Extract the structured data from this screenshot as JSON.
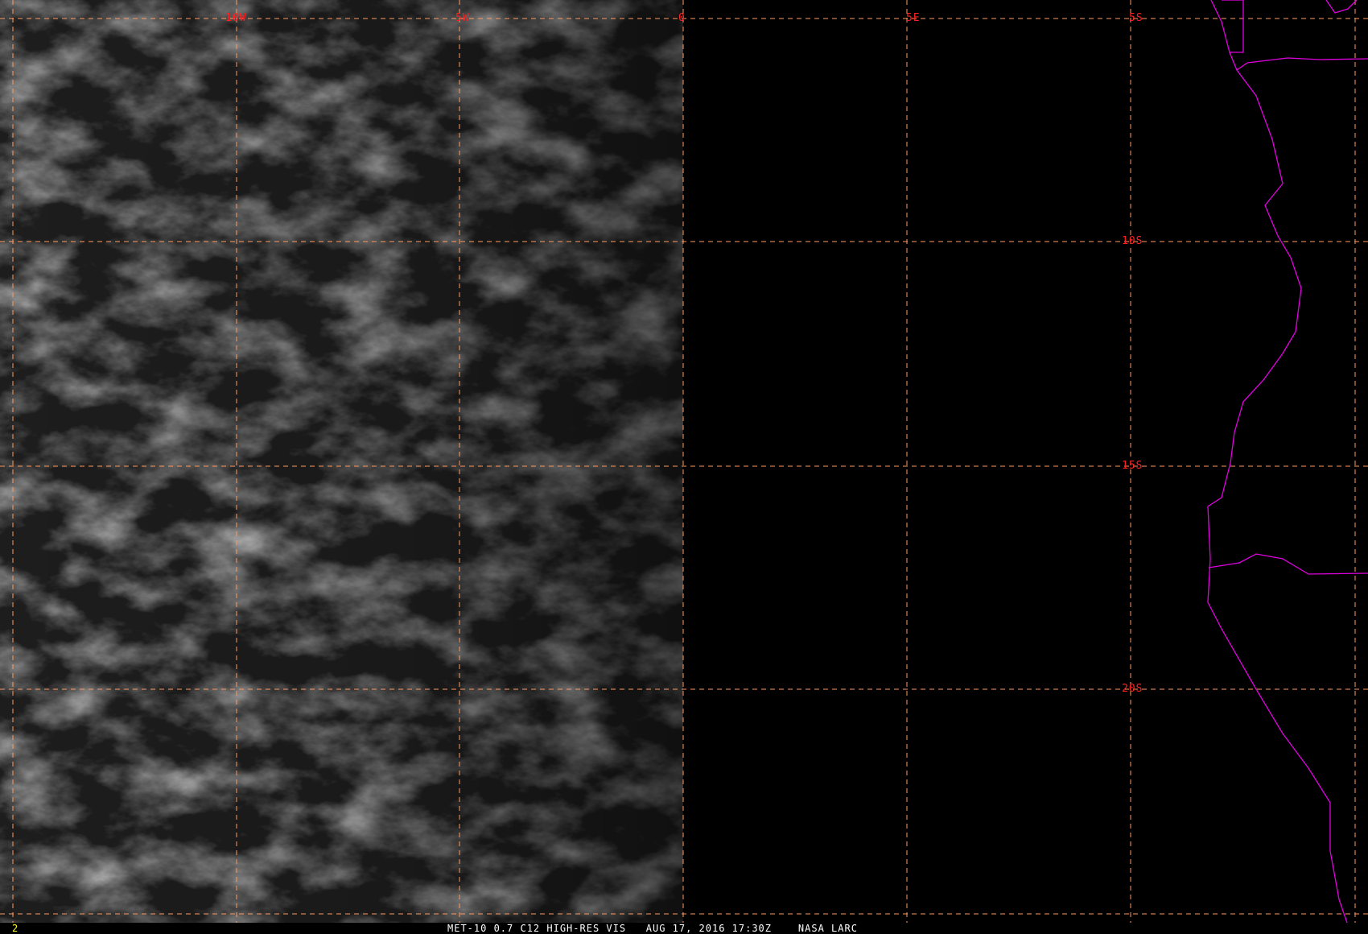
{
  "map": {
    "lon_labels": [
      "10W",
      "5W",
      "0",
      "5E"
    ],
    "lat_labels": [
      "5S",
      "10S",
      "15S",
      "20S"
    ],
    "colors": {
      "grid": "#ff9a60",
      "labels": "#ff2020",
      "coastline": "#e000e0",
      "frame_number": "#ffff30"
    }
  },
  "footer": {
    "frame_number": "2",
    "caption": "MET-10 0.7 C12 HIGH-RES VIS   AUG 17, 2016 17:30Z    NASA LARC"
  }
}
